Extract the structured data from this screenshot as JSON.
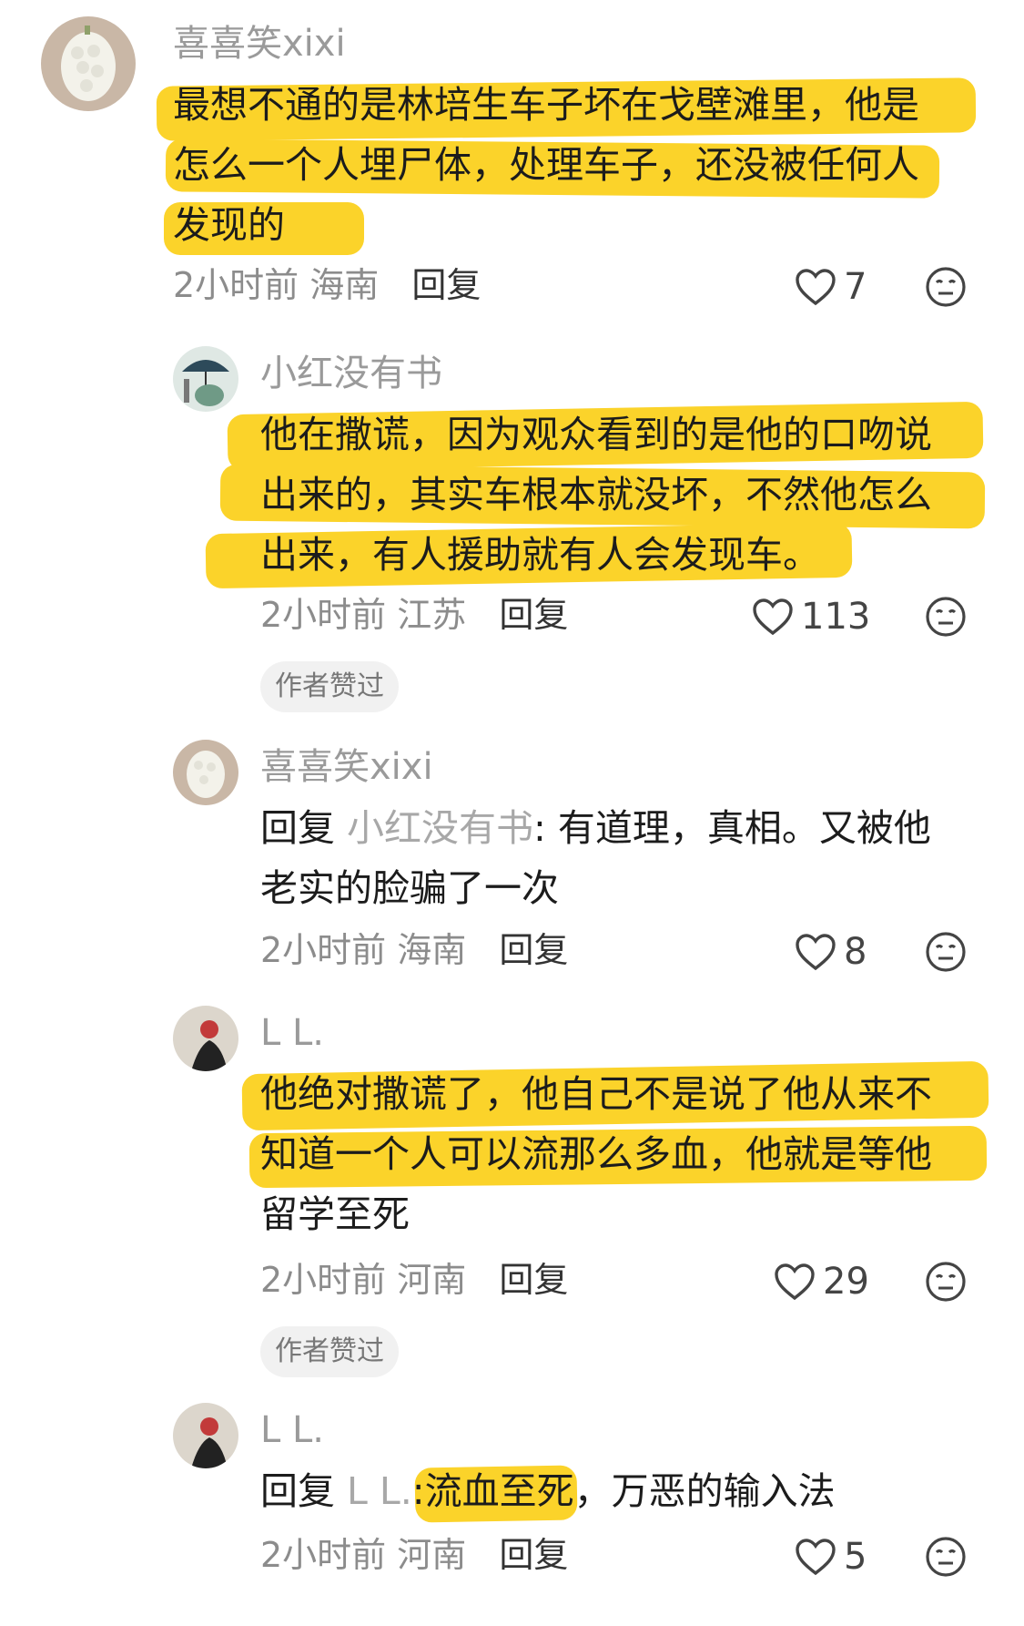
{
  "comments": [
    {
      "username": "喜喜笑xixi",
      "lines": [
        "最想不通的是林培生车子坏在戈壁滩里，他是",
        "怎么一个人埋尸体，处理车子，还没被任何人",
        "发现的"
      ],
      "time": "2小时前",
      "location": "海南",
      "reply_label": "回复",
      "likes": "7"
    },
    {
      "username": "小红没有书",
      "lines": [
        "他在撒谎，因为观众看到的是他的口吻说",
        "出来的，其实车根本就没坏，不然他怎么",
        "出来，有人援助就有人会发现车。"
      ],
      "time": "2小时前",
      "location": "江苏",
      "reply_label": "回复",
      "likes": "113",
      "badge": "作者赞过"
    },
    {
      "username": "喜喜笑xixi",
      "reply_prefix": "回复",
      "reply_to": "小红没有书",
      "lines": [
        ": 有道理，真相。又被他",
        "老实的脸骗了一次"
      ],
      "time": "2小时前",
      "location": "海南",
      "reply_label": "回复",
      "likes": "8"
    },
    {
      "username": "L L.",
      "lines": [
        "他绝对撒谎了，他自己不是说了他从来不",
        "知道一个人可以流那么多血，他就是等他",
        "留学至死"
      ],
      "time": "2小时前",
      "location": "河南",
      "reply_label": "回复",
      "likes": "29",
      "badge": "作者赞过"
    },
    {
      "username": "L L.",
      "reply_prefix": "回复",
      "reply_to": "L L.",
      "lines": [
        ":",
        "流血至死",
        "，万恶的输入法"
      ],
      "time": "2小时前",
      "location": "河南",
      "reply_label": "回复",
      "likes": "5"
    }
  ],
  "colors": {
    "highlight": "#fbd32a",
    "muted": "#9a9a9a"
  },
  "icons": {
    "like": "heart-outline-icon",
    "dislike": "neutral-face-icon"
  }
}
